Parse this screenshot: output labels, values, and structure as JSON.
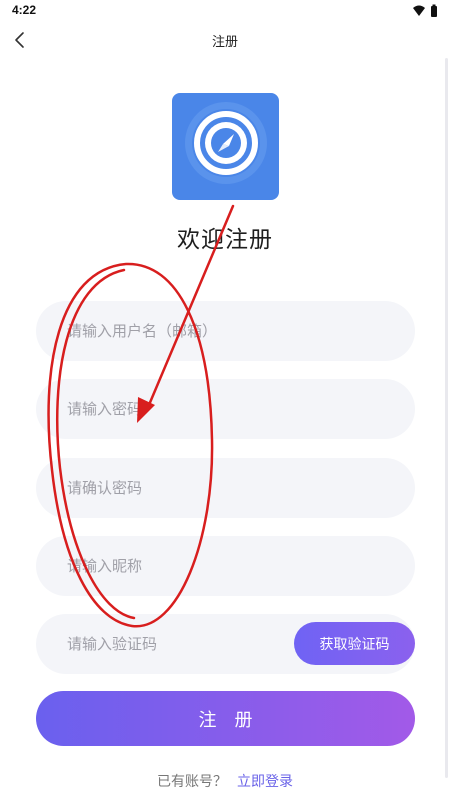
{
  "status_bar": {
    "time": "4:22"
  },
  "header": {
    "title": "注册"
  },
  "welcome": "欢迎注册",
  "form": {
    "username_placeholder": "请输入用户名（邮箱）",
    "password_placeholder": "请输入密码",
    "confirm_placeholder": "请确认密码",
    "nickname_placeholder": "请输入昵称",
    "code_placeholder": "请输入验证码",
    "get_code_label": "获取验证码",
    "submit_label": "注册"
  },
  "footer": {
    "prompt": "已有账号？",
    "login_link": "立即登录"
  },
  "icons": {
    "back": "chevron-left-icon",
    "logo": "compass-icon",
    "wifi": "wifi-icon",
    "battery": "battery-icon"
  },
  "colors": {
    "accent": "#6a60ee",
    "accent_end": "#a25ae8",
    "logo_bg": "#4a86e8",
    "annotation": "#d81e1e"
  }
}
